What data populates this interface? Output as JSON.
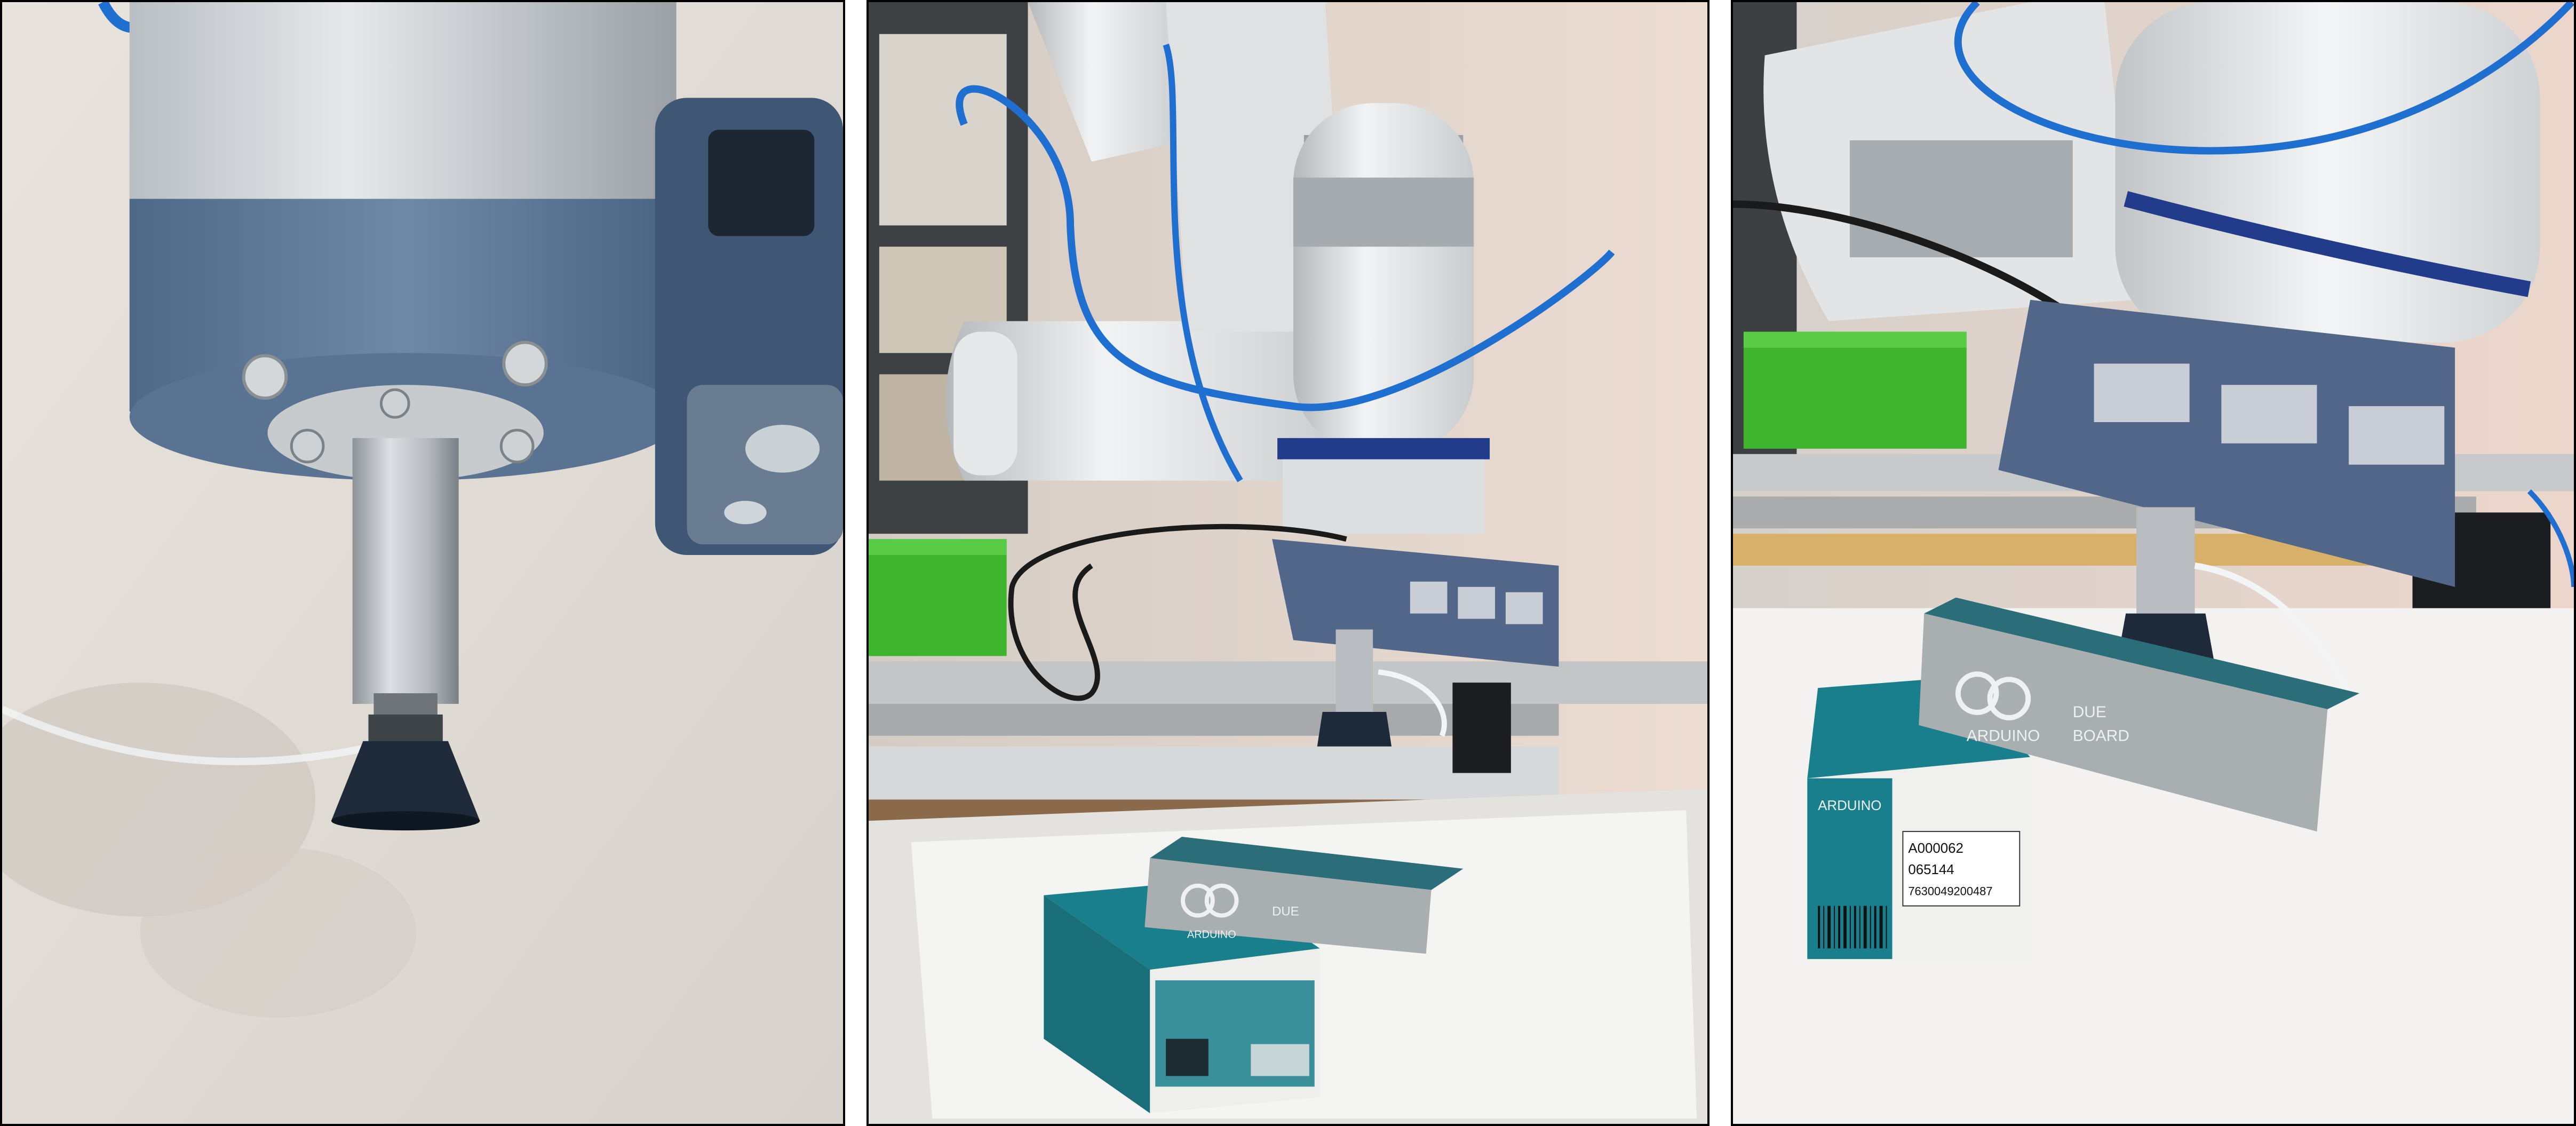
{
  "panels": [
    {
      "name": "suction-gripper-closeup"
    },
    {
      "name": "robot-arm-picking-box"
    },
    {
      "name": "suction-cup-holding-box"
    }
  ],
  "box_labels": {
    "brand": "ARDUINO",
    "product_line1": "DUE",
    "product_line2": "BOARD",
    "sku": "A000062",
    "code": "065144",
    "barcode_number": "7630049200487"
  },
  "colors": {
    "wall": "#e8e2dc",
    "flange_blue": "#5c7593",
    "arm_white": "#eceef0",
    "hose_blue": "#1f6fd1",
    "box_teal": "#1a7f8c",
    "box_gray": "#a9aeb1",
    "bin_green": "#3fb52f"
  }
}
